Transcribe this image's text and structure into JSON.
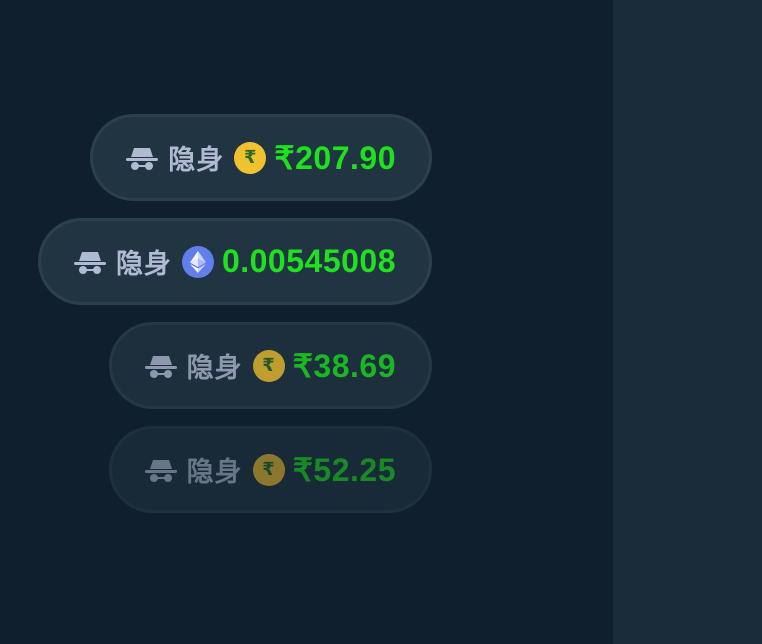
{
  "bets": [
    {
      "user": "隐身",
      "currency": "INR",
      "coin_symbol": "₹",
      "amount": "₹207.90"
    },
    {
      "user": "隐身",
      "currency": "ETH",
      "coin_symbol": "",
      "amount": "0.00545008"
    },
    {
      "user": "隐身",
      "currency": "INR",
      "coin_symbol": "₹",
      "amount": "₹38.69"
    },
    {
      "user": "隐身",
      "currency": "INR",
      "coin_symbol": "₹",
      "amount": "₹52.25"
    }
  ],
  "icons": {
    "user": "incognito-hat-icon",
    "inr": "rupee-coin-icon",
    "eth": "ethereum-coin-icon"
  },
  "colors": {
    "background": "#0f1f2d",
    "side_panel": "#1a2c3a",
    "pill": "#213442",
    "pill_border": "#2b3f4e",
    "username": "#b1bad3",
    "amount": "#1fe21f",
    "inr_coin": "#f1c230",
    "eth_coin": "#627eea"
  }
}
